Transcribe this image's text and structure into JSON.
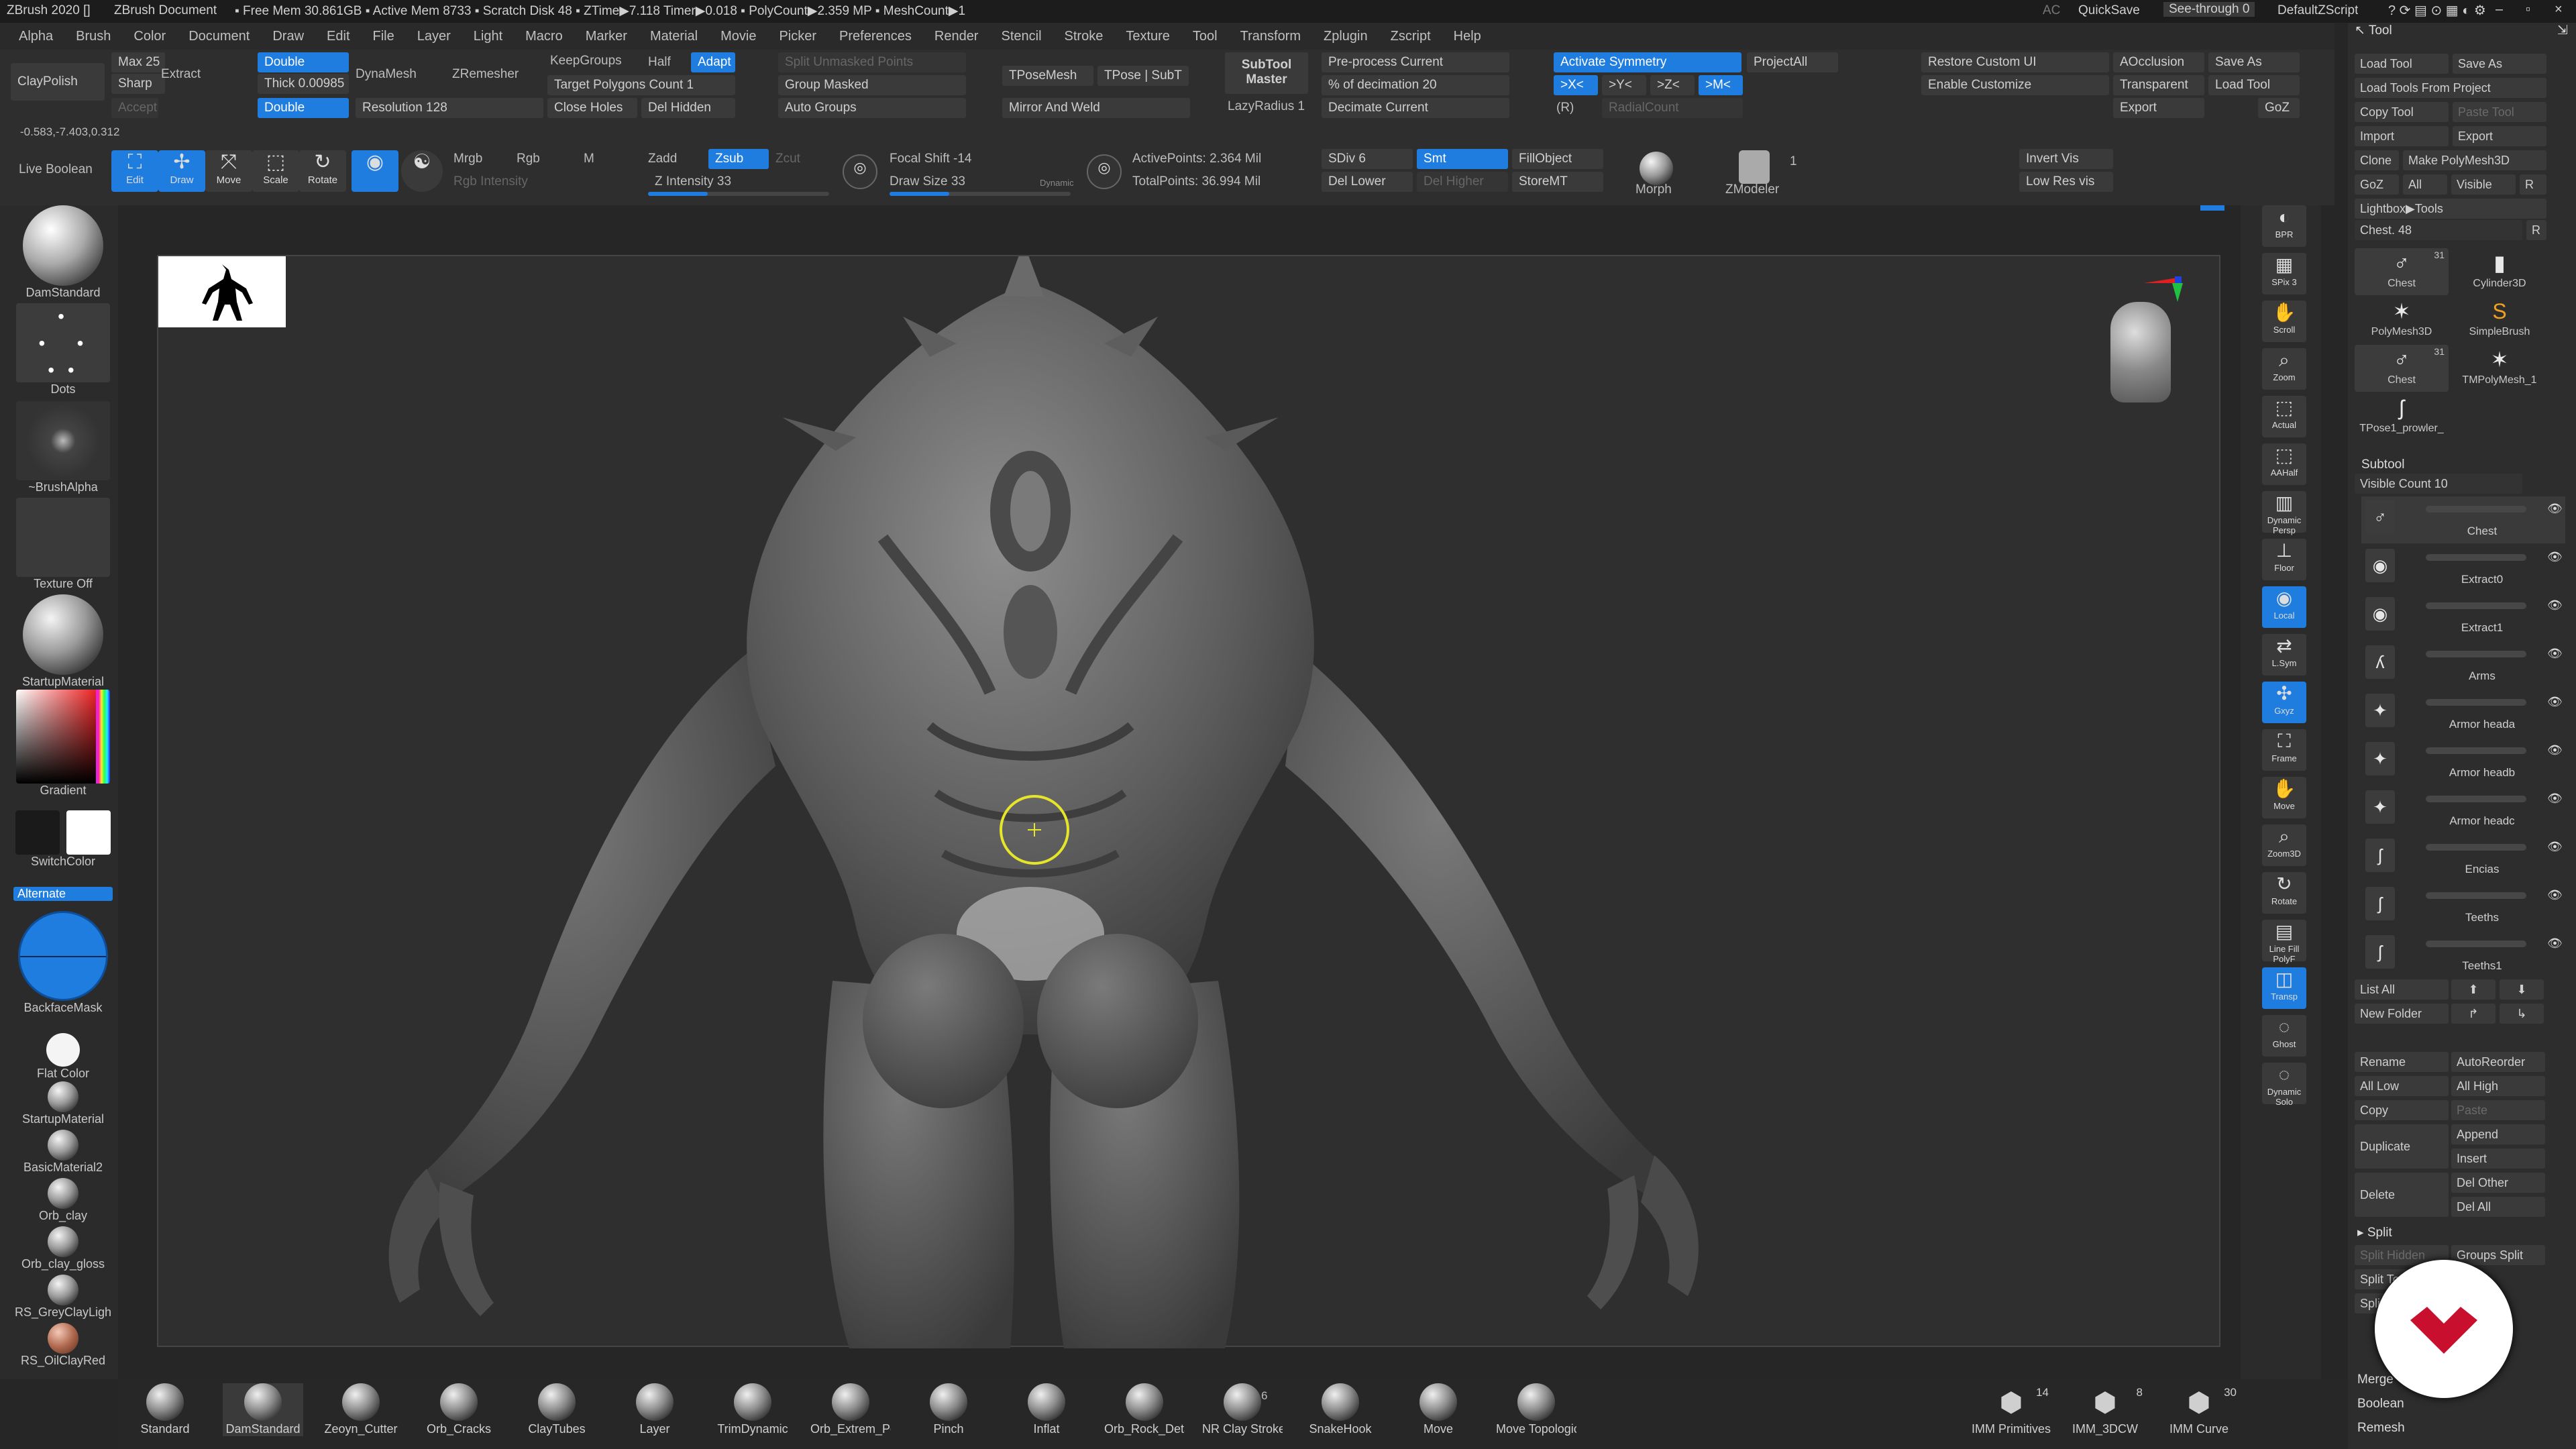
{
  "title": {
    "app": "ZBrush 2020 []",
    "doc": "ZBrush Document",
    "stats": "▪ Free Mem 30.861GB ▪ Active Mem 8733 ▪ Scratch Disk 48 ▪ ZTime▶7.118 Timer▶0.018 ▪ PolyCount▶2.359 MP ▪ MeshCount▶1",
    "ac": "AC",
    "quicksave": "QuickSave",
    "seethrough": "See-through 0",
    "script": "DefaultZScript"
  },
  "menu": [
    "Alpha",
    "Brush",
    "Color",
    "Document",
    "Draw",
    "Edit",
    "File",
    "Layer",
    "Light",
    "Macro",
    "Marker",
    "Material",
    "Movie",
    "Picker",
    "Preferences",
    "Render",
    "Stencil",
    "Stroke",
    "Texture",
    "Tool",
    "Transform",
    "Zplugin",
    "Zscript",
    "Help"
  ],
  "top": {
    "claypolish": "ClayPolish",
    "max": "Max 25",
    "sharp": "Sharp",
    "extract": "Extract",
    "accept": "Accept",
    "double1": "Double",
    "thick": "Thick 0.00985",
    "double2": "Double",
    "dynamesh": "DynaMesh",
    "resolution": "Resolution 128",
    "zremesher": "ZRemesher",
    "keepgroups": "KeepGroups",
    "half": "Half",
    "adapt": "Adapt",
    "target": "Target Polygons Count 1",
    "closeholes": "Close Holes",
    "delhidden": "Del Hidden",
    "splitunmasked": "Split Unmasked Points",
    "groupmasked": "Group Masked",
    "autogroups": "Auto Groups",
    "tposemesh": "TPoseMesh",
    "tposesubt": "TPose | SubT",
    "mirrorweld": "Mirror And Weld",
    "subtoolmaster": "SubTool Master",
    "lazyradius": "LazyRadius 1",
    "preprocess": "Pre-process Current",
    "decimation": "% of decimation 20",
    "decimatecurrent": "Decimate Current",
    "activatesym": "Activate Symmetry",
    "symx": ">X<",
    "symy": ">Y<",
    "symz": ">Z<",
    "symm": ">M<",
    "symr": "(R)",
    "radialcount": "RadialCount",
    "projectall": "ProjectAll",
    "restorecustom": "Restore Custom UI",
    "enablecustom": "Enable Customize",
    "aocclusion": "AOcclusion",
    "transparent": "Transparent",
    "export": "Export",
    "saveas": "Save As",
    "loadtool": "Load Tool",
    "goz": "GoZ",
    "coords": "-0.583,-7.403,0.312",
    "liveboolean": "Live Boolean",
    "edit": "Edit",
    "draw": "Draw",
    "move": "Move",
    "scale": "Scale",
    "rotate": "Rotate",
    "mrgb": "Mrgb",
    "rgb": "Rgb",
    "m": "M",
    "rgbintensity": "Rgb Intensity",
    "zadd": "Zadd",
    "zsub": "Zsub",
    "zcut": "Zcut",
    "zintensity": "Z Intensity 33",
    "focalshift": "Focal Shift -14",
    "drawsize": "Draw Size 33",
    "dynamic": "Dynamic",
    "activepoints": "ActivePoints: 2.364 Mil",
    "totalpoints": "TotalPoints: 36.994 Mil",
    "sdiv": "SDiv 6",
    "smt": "Smt",
    "dellower": "Del Lower",
    "delhigher": "Del Higher",
    "fillobject": "FillObject",
    "storemt": "StoreMT",
    "morph": "Morph",
    "zmodeler": "ZModeler",
    "zmodelercount": "1",
    "invertvis": "Invert Vis",
    "lowresvis": "Low Res vis",
    "zintensity_val": 0.33,
    "drawsize_val": 0.33
  },
  "left": {
    "brush": "DamStandard",
    "stroke": "Dots",
    "alpha": "~BrushAlpha",
    "texture": "Texture Off",
    "material": "StartupMaterial",
    "gradient": "Gradient",
    "switchcolor": "SwitchColor",
    "alternate": "Alternate",
    "backfacemask": "BackfaceMask",
    "flatcolor": "Flat Color",
    "materials": [
      "StartupMaterial",
      "BasicMaterial2",
      "Orb_clay",
      "Orb_clay_gloss",
      "RS_GreyClayLigh",
      "RS_OilClayRed"
    ],
    "colors": {
      "primary": "#1a1a1a",
      "secondary": "#ffffff",
      "accent": "#1f7de0"
    }
  },
  "right": [
    "BPR",
    "SPix 3",
    "Scroll",
    "Zoom",
    "Actual",
    "AAHalf",
    "Dynamic Persp",
    "Floor",
    "Local",
    "L.Sym",
    "Gxyz",
    "Frame",
    "Move",
    "Zoom3D",
    "Rotate",
    "Line Fill PolyF",
    "Transp",
    "Ghost",
    "Dynamic Solo"
  ],
  "tool": {
    "title": "Tool",
    "loadtool": "Load Tool",
    "saveas": "Save As",
    "loadfromproject": "Load Tools From Project",
    "copytool": "Copy Tool",
    "pastetool": "Paste Tool",
    "import": "Import",
    "export": "Export",
    "clone": "Clone",
    "makepolymesh": "Make PolyMesh3D",
    "goz": "GoZ",
    "all": "All",
    "visible": "Visible",
    "r": "R",
    "lightbox": "Lightbox▶Tools",
    "chest": "Chest. 48",
    "r2": "R",
    "thumbs": [
      {
        "name": "Chest",
        "count": "31",
        "glyph": "♂"
      },
      {
        "name": "Cylinder3D",
        "count": "",
        "glyph": "▮"
      },
      {
        "name": "PolyMesh3D",
        "count": "",
        "glyph": "✶"
      },
      {
        "name": "SimpleBrush",
        "count": "",
        "glyph": "S"
      },
      {
        "name": "Chest",
        "count": "31",
        "glyph": "♂"
      },
      {
        "name": "TMPolyMesh_1",
        "count": "",
        "glyph": "✶"
      },
      {
        "name": "TPose1_prowler_",
        "count": "",
        "glyph": "ʃ"
      }
    ],
    "subtool": "Subtool",
    "visiblecount": "Visible Count 10",
    "subtools": [
      "Chest",
      "Extract0",
      "Extract1",
      "Arms",
      "Armor heada",
      "Armor headb",
      "Armor headc",
      "Encias",
      "Teeths",
      "Teeths1"
    ],
    "listall": "List All",
    "newfolder": "New Folder",
    "rename": "Rename",
    "autoreorder": "AutoReorder",
    "alllow": "All Low",
    "allhigh": "All High",
    "copy": "Copy",
    "paste": "Paste",
    "duplicate": "Duplicate",
    "append": "Append",
    "insert": "Insert",
    "delete": "Delete",
    "delother": "Del Other",
    "delall": "Del All",
    "split": "Split",
    "splithidden": "Split Hidden",
    "groupssplit": "Groups Split",
    "splitto": "Split To",
    "splitb": "Split",
    "merge": "Merge",
    "boolean": "Boolean",
    "remesh": "Remesh"
  },
  "bottom": [
    "Standard",
    "DamStandard",
    "Zeoyn_Cutter",
    "Orb_Cracks",
    "ClayTubes",
    "Layer",
    "TrimDynamic",
    "Orb_Extrem_Poli",
    "Pinch",
    "Inflat",
    "Orb_Rock_Detail",
    "NR Clay Strokes I",
    "SnakeHook",
    "Move",
    "Move Topologic"
  ],
  "bottom_badge": "6",
  "insert": [
    {
      "name": "IMM Primitives",
      "count": "14"
    },
    {
      "name": "IMM_3DCW",
      "count": "8"
    },
    {
      "name": "IMM Curve",
      "count": "30"
    }
  ]
}
